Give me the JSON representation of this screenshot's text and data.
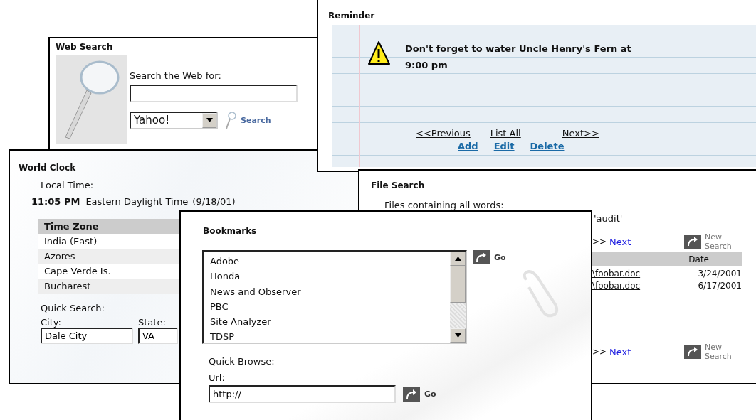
{
  "web_search": {
    "title": "Web Search",
    "prompt": "Search the Web for:",
    "engine": "Yahoo!",
    "search_link": "Search"
  },
  "reminder": {
    "title": "Reminder",
    "message": "Don't forget to water Uncle Henry's Fern at 9:00 pm",
    "nav": [
      "<<Previous",
      "List All",
      "Next>>"
    ],
    "actions": [
      "Add",
      "Edit",
      "Delete"
    ]
  },
  "world_clock": {
    "title": "World Clock",
    "local_time_label": "Local Time:",
    "time": "11:05 PM",
    "zone": "Eastern Daylight Time",
    "date": "(9/18/01)",
    "table": {
      "columns": [
        "Time Zone"
      ],
      "rows": [
        "India (East)",
        "Azores",
        "Cape Verde Is.",
        "Bucharest"
      ]
    },
    "quick_search_label": "Quick Search:",
    "city_label": "City:",
    "city_value": "Dale City",
    "state_label": "State:",
    "state_value": "VA"
  },
  "file_search": {
    "title": "File Search",
    "criteria_label": "Files containing all words:",
    "criteria_value": "'audit'",
    "pagers": [
      {
        "arrows": ">>",
        "link": "Next",
        "new_search": "New Search"
      },
      {
        "arrows": ">>",
        "link": "Next",
        "new_search": "New Search"
      }
    ],
    "table": {
      "columns": [
        "Date"
      ],
      "rows": [
        {
          "file": "\\foobar.doc",
          "date": "3/24/2001"
        },
        {
          "file": "\\foobar.doc",
          "date": "6/17/2001"
        }
      ]
    }
  },
  "bookmarks": {
    "title": "Bookmarks",
    "items": [
      "Adobe",
      "Honda",
      "News and Observer",
      "PBC",
      "Site Analyzer",
      "TDSP"
    ],
    "go": "Go",
    "quick_browse_label": "Quick Browse:",
    "url_label": "Url:",
    "url_value": "http://",
    "url_go": "Go"
  }
}
